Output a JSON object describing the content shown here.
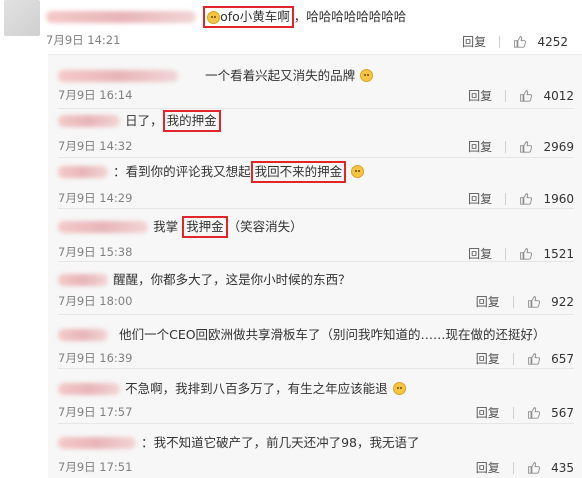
{
  "main_comment": {
    "text_parts": [
      "ofo小黄车啊",
      "，哈哈哈哈哈哈哈哈"
    ],
    "date": "7月9日 14:21",
    "reply": "回复",
    "likes": "4252"
  },
  "replies": [
    {
      "text": "一个看着兴起又消失的品牌",
      "date": "7月9日 16:14",
      "likes": "4012"
    },
    {
      "text_parts": [
        "日了，",
        "我的押金"
      ],
      "date": "7月9日 14:32",
      "likes": "2969"
    },
    {
      "text_parts": [
        "：看到你的评论我又想起",
        "我回不来的押金"
      ],
      "date": "7月9日 14:29",
      "likes": "1960"
    },
    {
      "text_parts": [
        "我掌 ",
        "我押金",
        "（笑容消失）"
      ],
      "date": "7月9日 15:38",
      "likes": "1521"
    },
    {
      "text": "醒醒，你都多大了，这是你小时候的东西？",
      "date": "7月9日 18:00",
      "likes": "922"
    },
    {
      "text": "他们一个CEO回欧洲做共享滑板车了（别问我咋知道的……现在做的还挺好）",
      "date": "7月9日 16:39",
      "likes": "657"
    },
    {
      "text": "不急啊，我排到八百多万了，有生之年应该能退",
      "date": "7月9日 17:57",
      "likes": "567"
    },
    {
      "text": "：我不知道它破产了，前几天还冲了98，我无语了",
      "date": "7月9日 17:51",
      "likes": "435"
    }
  ],
  "reply_label": "回复",
  "icons": {
    "like": "thumb-up-icon",
    "emoji": "smiley-face-icon"
  },
  "colors": {
    "highlight": "#e0262a",
    "panel": "#f7f7f7"
  }
}
